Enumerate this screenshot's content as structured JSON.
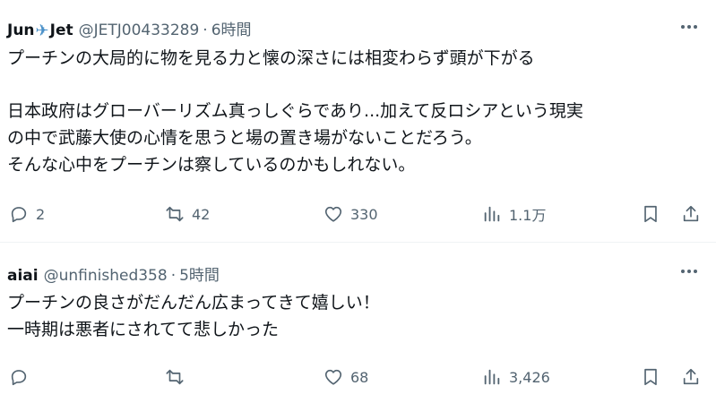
{
  "tweets": [
    {
      "name_part1": "Jun",
      "name_part2": "Jet",
      "handle": "@JETJ00433289",
      "separator": "·",
      "time": "6時間",
      "lines": [
        "プーチンの大局的に物を見る力と懐の深さには相変わらず頭が下がる",
        "",
        "日本政府はグローバーリズム真っしぐらであり...加えて反ロシアという現実",
        "の中で武藤大使の心情を思うと場の置き場がないことだろう。",
        "そんな心中をプーチンは察しているのかもしれない。"
      ],
      "replies": "2",
      "retweets": "42",
      "likes": "330",
      "views": "1.1万"
    },
    {
      "name": "aiai",
      "handle": "@unfinished358",
      "separator": "·",
      "time": "5時間",
      "lines": [
        "プーチンの良さがだんだん広まってきて嬉しい！",
        "一時期は悪者にされてて悲しかった"
      ],
      "replies": "",
      "retweets": "",
      "likes": "68",
      "views": "3,426"
    }
  ],
  "icons": {
    "name_emoji": "airplane-emoji",
    "more": "more-icon",
    "reply": "reply-icon",
    "retweet": "retweet-icon",
    "like": "like-icon",
    "views": "views-icon",
    "bookmark": "bookmark-icon",
    "share": "share-icon"
  },
  "colors": {
    "text": "#0f1419",
    "secondary": "#536471",
    "divider": "#eff3f4"
  }
}
